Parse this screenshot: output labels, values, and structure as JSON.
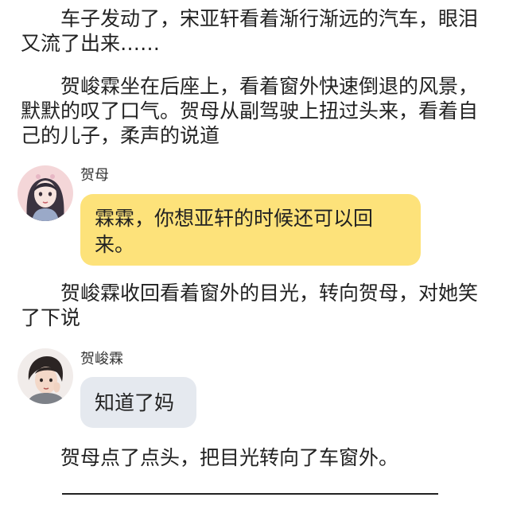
{
  "paragraphs": {
    "p1": "　　车子发动了，宋亚轩看着渐行渐远的汽车，眼泪又流了出来……",
    "p2": "　　贺峻霖坐在后座上，看着窗外快速倒退的风景，默默的叹了口气。贺母从副驾驶上扭过头来，看着自己的儿子，柔声的说道",
    "p3": "　　贺峻霖收回看着窗外的目光，转向贺母，对她笑了下说",
    "p4": "　　贺母点了点头，把目光转向了车窗外。"
  },
  "messages": [
    {
      "speaker": "贺母",
      "text": "霖霖，你想亚轩的时候还可以回来。",
      "bubble_color": "#fde27a"
    },
    {
      "speaker": "贺峻霖",
      "text": "知道了妈",
      "bubble_color": "#e5e9ef"
    }
  ],
  "icons": {
    "mother_avatar": "female-character-avatar",
    "son_avatar": "male-character-avatar"
  }
}
